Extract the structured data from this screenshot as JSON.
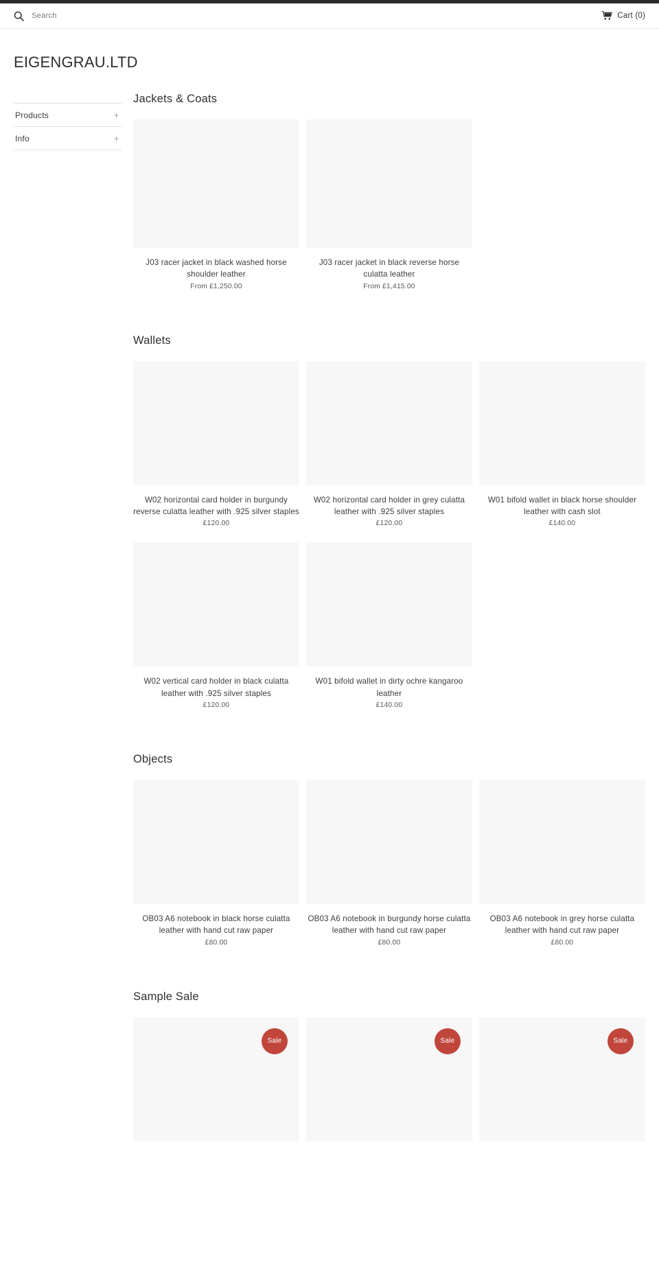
{
  "top_bar": {
    "search": {
      "icon": "search-icon",
      "placeholder": "Search",
      "value": ""
    },
    "cart": {
      "icon": "shopping-cart-icon",
      "label": "Cart (0)"
    }
  },
  "header": {
    "site_title": "EIGENGRAU.LTD"
  },
  "sidebar": {
    "items": [
      {
        "label": "Products",
        "toggle": "+"
      },
      {
        "label": "Info",
        "toggle": "+"
      }
    ]
  },
  "colors": {
    "sale_badge": "#c0463c",
    "placeholder": "#f7f7f7",
    "top_strip": "#2b2b2b",
    "text": "#333333"
  },
  "collections": [
    {
      "title": "Jackets & Coats",
      "products": [
        {
          "title": "J03 racer jacket in black washed horse shoulder leather",
          "price": "From £1,250.00",
          "sale": false
        },
        {
          "title": "J03 racer jacket in black reverse horse culatta leather",
          "price": "From £1,415.00",
          "sale": false
        }
      ]
    },
    {
      "title": "Wallets",
      "products": [
        {
          "title": "W02 horizontal card holder in burgundy reverse culatta leather with .925 silver staples",
          "price": "£120.00",
          "sale": false
        },
        {
          "title": "W02 horizontal card holder in grey culatta leather with .925 silver staples",
          "price": "£120.00",
          "sale": false
        },
        {
          "title": "W01 bifold wallet in black horse shoulder leather with cash slot",
          "price": "£140.00",
          "sale": false
        },
        {
          "title": "W02 vertical card holder in black culatta leather with .925 silver staples",
          "price": "£120.00",
          "sale": false
        },
        {
          "title": "W01 bifold wallet in dirty ochre kangaroo leather",
          "price": "£140.00",
          "sale": false
        }
      ]
    },
    {
      "title": "Objects",
      "products": [
        {
          "title": "OB03 A6 notebook in black horse culatta leather with hand cut raw paper",
          "price": "£80.00",
          "sale": false
        },
        {
          "title": "OB03 A6 notebook in burgundy horse culatta leather with hand cut raw paper",
          "price": "£80.00",
          "sale": false
        },
        {
          "title": "OB03 A6 notebook in grey horse culatta leather with hand cut raw paper",
          "price": "£80.00",
          "sale": false
        }
      ]
    },
    {
      "title": "Sample Sale",
      "products": [
        {
          "title": "",
          "price": "",
          "sale": true,
          "sale_label": "Sale"
        },
        {
          "title": "",
          "price": "",
          "sale": true,
          "sale_label": "Sale"
        },
        {
          "title": "",
          "price": "",
          "sale": true,
          "sale_label": "Sale"
        }
      ]
    }
  ]
}
